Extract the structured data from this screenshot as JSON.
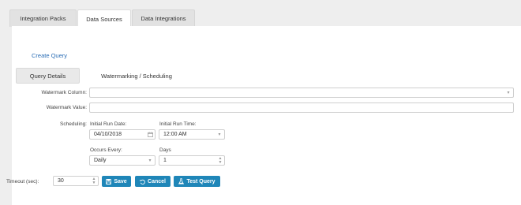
{
  "tabs": [
    {
      "label": "Integration Packs"
    },
    {
      "label": "Data Sources"
    },
    {
      "label": "Data Integrations"
    }
  ],
  "create_query": "Create Query",
  "subtabs": [
    {
      "label": "Query Details"
    },
    {
      "label": "Watermarking / Scheduling"
    }
  ],
  "form": {
    "watermark_column_label": "Watermark Column:",
    "watermark_column_value": "",
    "watermark_value_label": "Watermark Value:",
    "watermark_value_value": "",
    "scheduling_label": "Scheduling:",
    "initial_run_date_label": "Initial Run Date:",
    "initial_run_date_value": "04/10/2018",
    "initial_run_time_label": "Initial Run Time:",
    "initial_run_time_value": "12:00 AM",
    "occurs_every_label": "Occurs Every:",
    "occurs_every_value": "Daily",
    "days_label": "Days",
    "days_value": "1",
    "timeout_label": "Timeout (sec):",
    "timeout_value": "30"
  },
  "buttons": {
    "save": "Save",
    "cancel": "Cancel",
    "test_query": "Test Query"
  },
  "icons": {
    "save": "floppy-disk-icon",
    "cancel": "undo-icon",
    "test_query": "flask-icon",
    "calendar": "calendar-icon"
  },
  "colors": {
    "accent": "#1f86b8",
    "link": "#2a6db5",
    "background": "#eeeeee"
  }
}
